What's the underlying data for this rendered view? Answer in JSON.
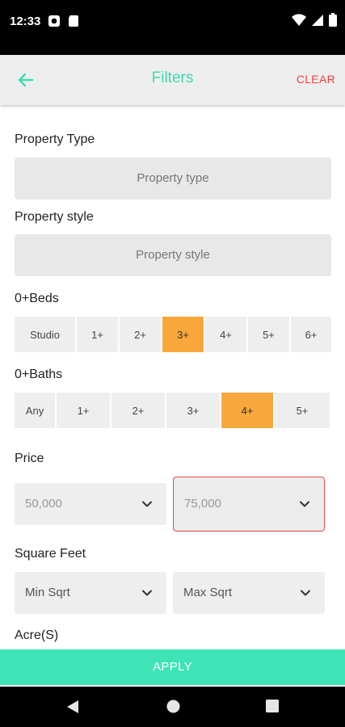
{
  "status": {
    "time": "12:33"
  },
  "appbar": {
    "title": "Filters",
    "clear_label": "CLEAR"
  },
  "property_type": {
    "label": "Property Type",
    "placeholder": "Property type"
  },
  "property_style": {
    "label": "Property style",
    "placeholder": "Property style"
  },
  "beds": {
    "label": "0+Beds",
    "options": [
      "Studio",
      "1+",
      "2+",
      "3+",
      "4+",
      "5+",
      "6+"
    ],
    "selected": "3+"
  },
  "baths": {
    "label": "0+Baths",
    "options": [
      "Any",
      "1+",
      "2+",
      "3+",
      "4+",
      "5+"
    ],
    "selected": "4+"
  },
  "price": {
    "label": "Price",
    "min": "50,000",
    "max": "75,000"
  },
  "square_feet": {
    "label": "Square Feet",
    "min": "Min Sqrt",
    "max": "Max Sqrt"
  },
  "acres": {
    "label": "Acre(S)"
  },
  "apply_label": "APPLY",
  "colors": {
    "accent": "#3ddbb0",
    "apply_bg": "#3ee3b6",
    "selected": "#f8a73c",
    "danger": "#f0413c"
  }
}
